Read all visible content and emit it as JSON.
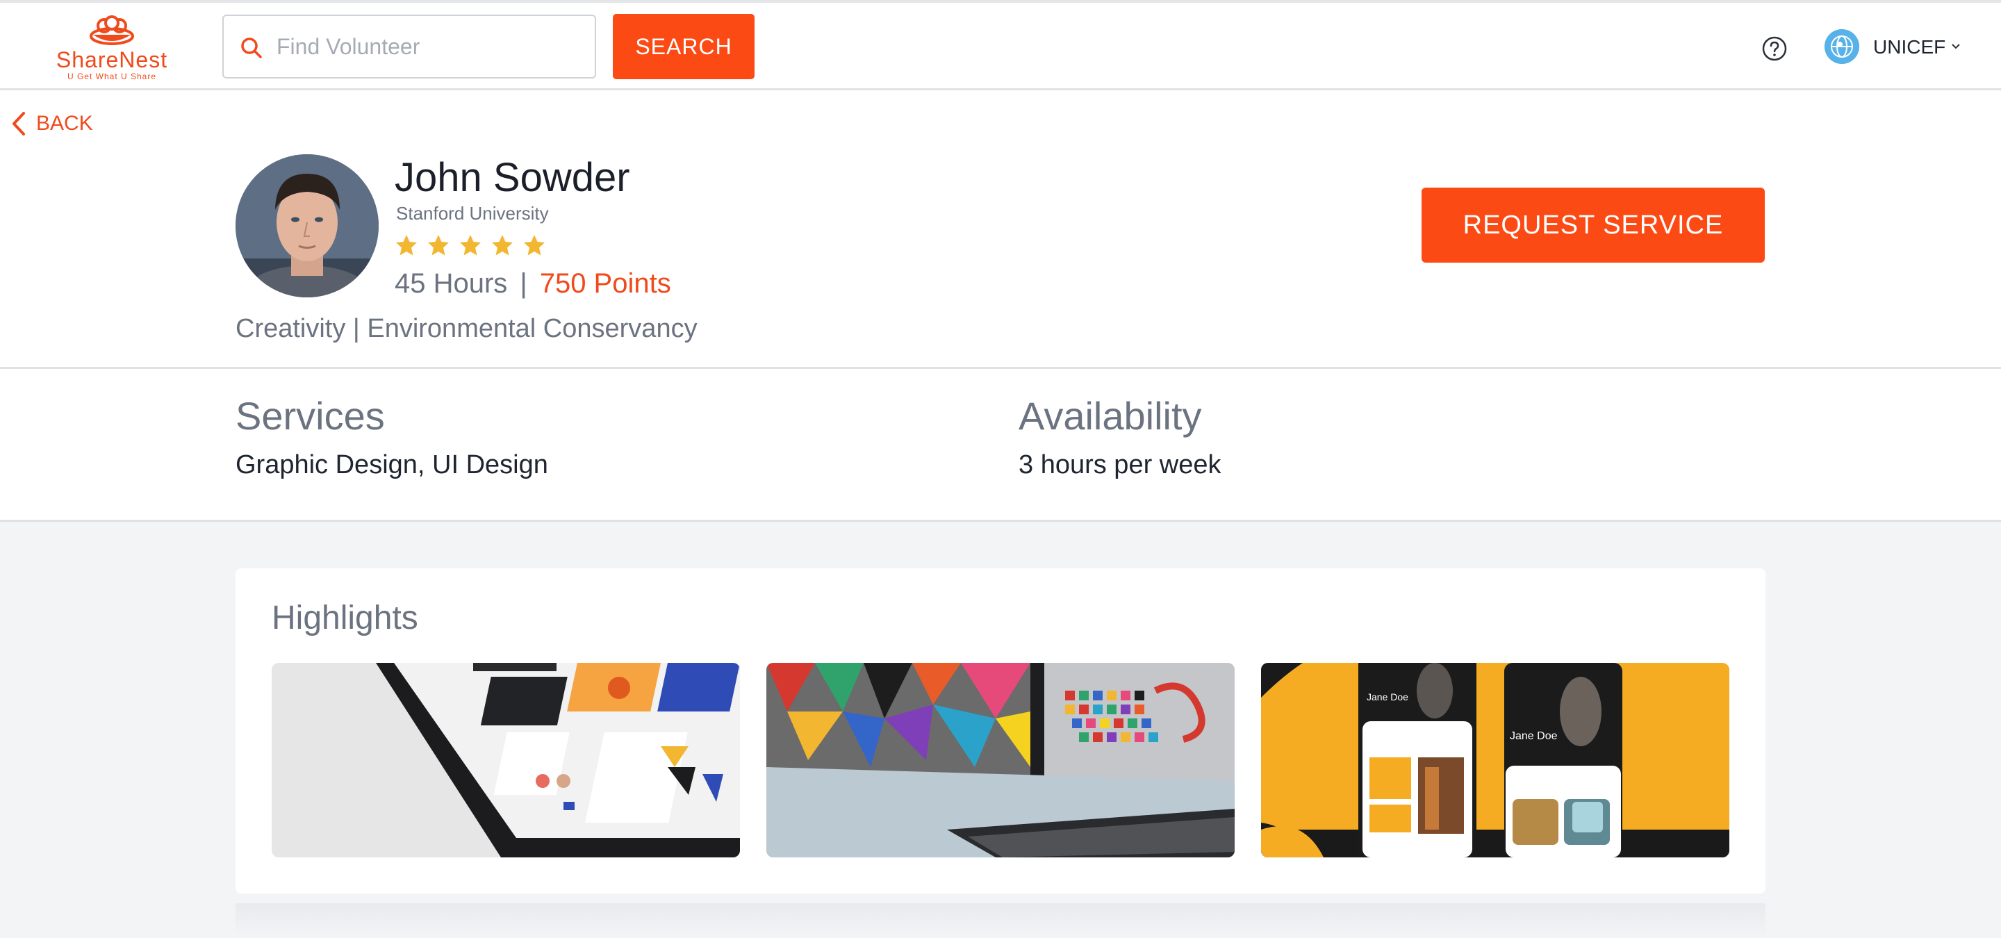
{
  "header": {
    "logo_name": "ShareNest",
    "logo_tagline": "U Get What U Share",
    "search_placeholder": "Find Volunteer",
    "search_button": "SEARCH",
    "org_name": "UNICEF"
  },
  "nav": {
    "back_label": "BACK"
  },
  "profile": {
    "name": "John Sowder",
    "university": "Stanford University",
    "rating": 5,
    "hours": "45 Hours",
    "separator": "|",
    "points": "750 Points",
    "interests": "Creativity | Environmental Conservancy",
    "request_button": "REQUEST SERVICE"
  },
  "services": {
    "title": "Services",
    "value": "Graphic Design, UI Design"
  },
  "availability": {
    "title": "Availability",
    "value": "3 hours per week"
  },
  "highlights": {
    "title": "Highlights",
    "items": [
      {
        "alt": "tablet with design layouts"
      },
      {
        "alt": "laptop with colorful pattern"
      },
      {
        "alt": "mobile app screens",
        "profile_text": "Jane Doe"
      }
    ]
  },
  "colors": {
    "accent": "#fc4a14",
    "star": "#f2b630",
    "highlight_yellow": "#f5ac23"
  },
  "icons": [
    "search-icon",
    "help-icon",
    "chevron-down-icon",
    "chevron-left-icon",
    "star-icon"
  ]
}
